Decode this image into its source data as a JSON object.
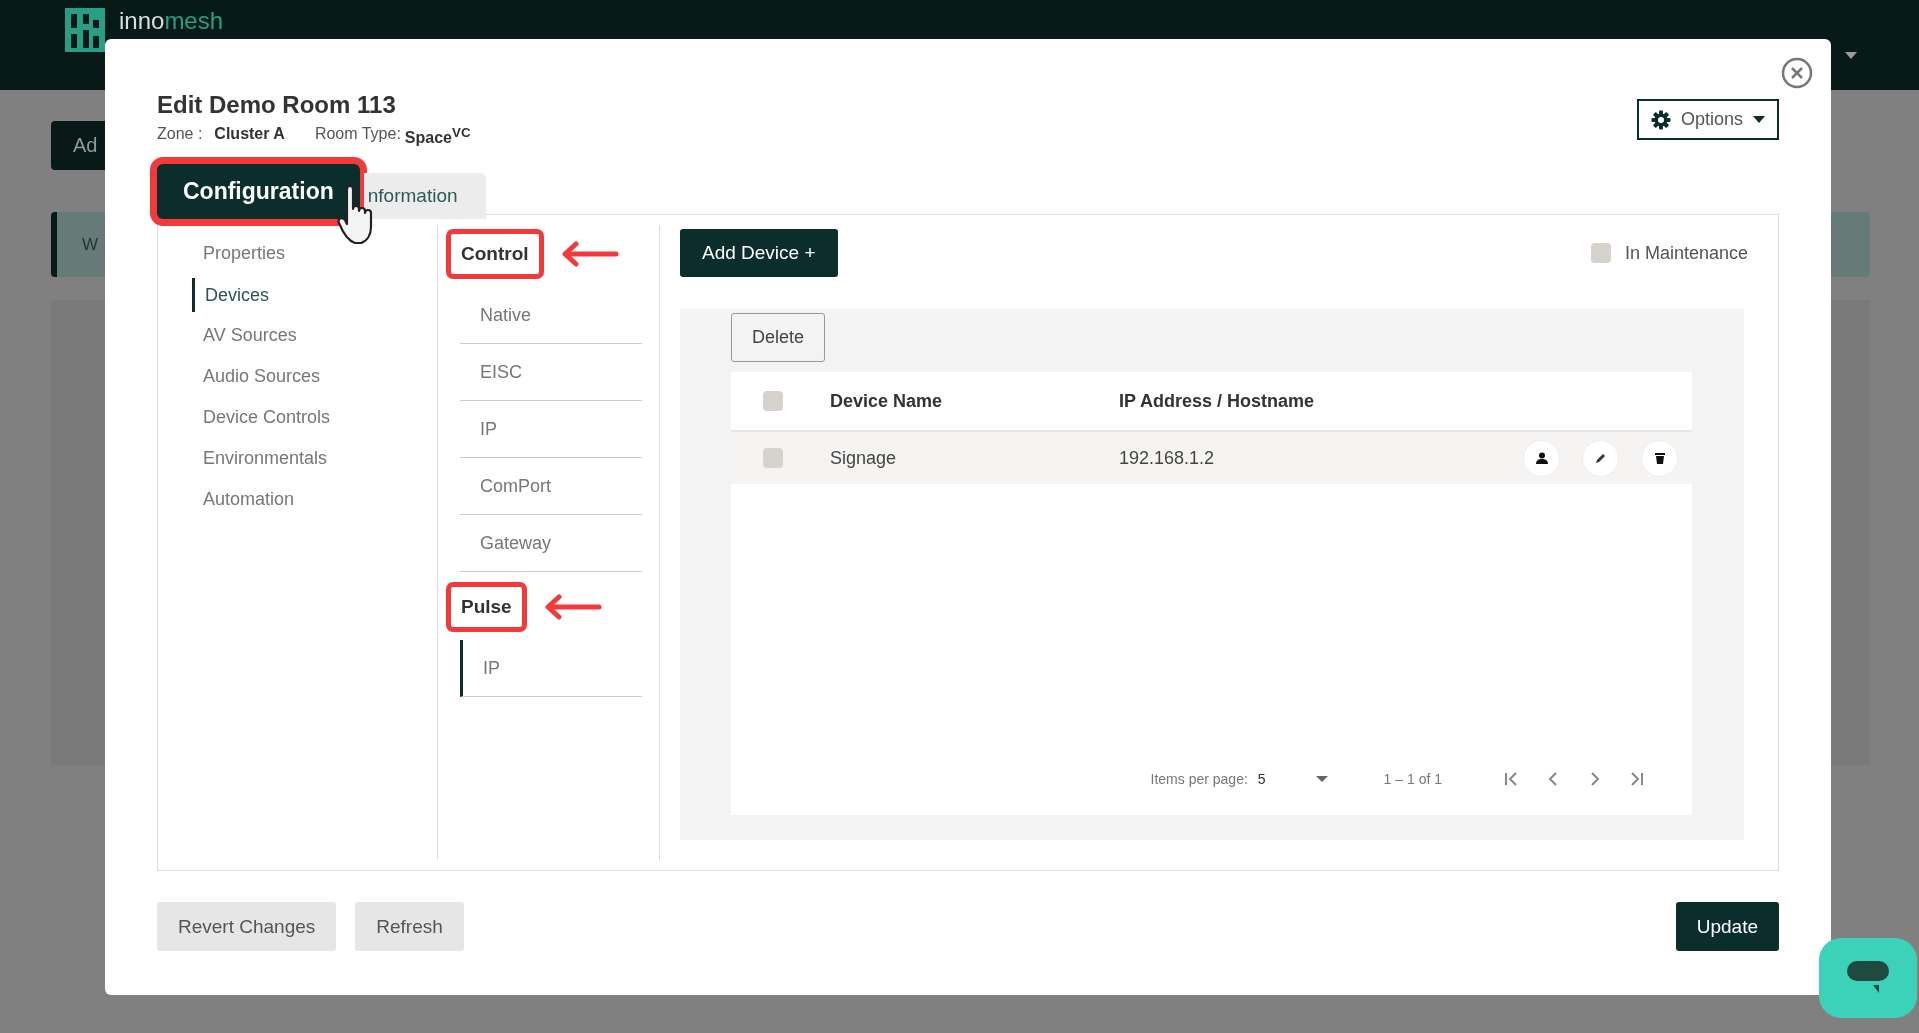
{
  "header": {
    "logo_prefix": "inno",
    "logo_suffix": "mesh"
  },
  "background": {
    "button": "Ad",
    "banner": "W"
  },
  "dialog": {
    "title": "Edit Demo Room 113",
    "zone_label": "Zone :",
    "zone": "Cluster A",
    "room_type_label": "Room Type:",
    "room_type": "Space$^{VC}$",
    "options_button": "Options"
  },
  "tabs": [
    {
      "label": "Configuration",
      "selected": true,
      "highlighted": true
    },
    {
      "label": "nformation",
      "selected": false,
      "highlighted": false
    }
  ],
  "nav": [
    {
      "label": "Properties",
      "selected": false
    },
    {
      "label": "Devices",
      "selected": true
    },
    {
      "label": "AV Sources",
      "selected": false
    },
    {
      "label": "Audio Sources",
      "selected": false
    },
    {
      "label": "Device Controls",
      "selected": false
    },
    {
      "label": "Environmentals",
      "selected": false
    },
    {
      "label": "Automation",
      "selected": false
    }
  ],
  "device_groups": [
    {
      "heading": "Control",
      "highlighted": true,
      "items": [
        {
          "label": "Native",
          "selected": false
        },
        {
          "label": "EISC",
          "selected": false
        },
        {
          "label": "IP",
          "selected": false
        },
        {
          "label": "ComPort",
          "selected": false
        },
        {
          "label": "Gateway",
          "selected": false
        }
      ]
    },
    {
      "heading": "Pulse",
      "highlighted": true,
      "items": [
        {
          "label": "IP",
          "selected": true
        }
      ]
    }
  ],
  "add_device_button": "Add Device +",
  "maintenance": {
    "label": "In Maintenance",
    "checked": false
  },
  "delete_button": "Delete",
  "table": {
    "columns": [
      "Device Name",
      "IP Address / Hostname"
    ],
    "all_checked": false,
    "rows": [
      {
        "name": "Signage",
        "address": "192.168.1.2",
        "checked": false
      }
    ]
  },
  "pagination": {
    "items_per_page_label": "Items per page:",
    "page_size": "5",
    "range": "1 – 1 of 1"
  },
  "footer_buttons": [
    {
      "label": "Revert Changes",
      "kind": "secondary"
    },
    {
      "label": "Refresh",
      "kind": "secondary"
    },
    {
      "label": "Update",
      "kind": "primary"
    }
  ]
}
